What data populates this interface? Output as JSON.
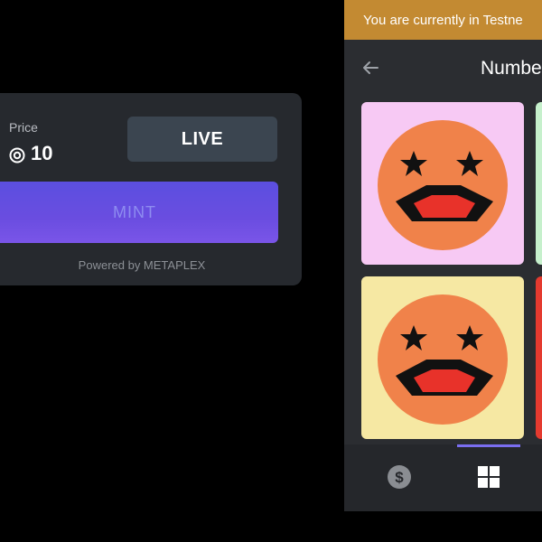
{
  "mint_card": {
    "price_label": "Price",
    "price_value": "10",
    "live_label": "LIVE",
    "mint_label": "MINT",
    "powered_by": "Powered by METAPLEX",
    "icons": {
      "price": "sol-coin-icon"
    }
  },
  "phone": {
    "banner_text": "You are currently in Testne",
    "title": "Numbe",
    "icons": {
      "back": "back-arrow-icon",
      "nav_wallet": "dollar-coin-icon",
      "nav_gallery": "grid-icon"
    },
    "tiles": [
      {
        "bg": "#f7c9f4",
        "icon": "star-eyes-face-icon"
      },
      {
        "bg": "#f6e8a3",
        "icon": "star-eyes-face-icon"
      }
    ],
    "colors": {
      "banner": "#c38a32",
      "face": "#f0824a",
      "mouth": "#e8322a",
      "nav_indicator": "#7a6ef0"
    }
  },
  "colors": {
    "mint_gradient_start": "#5b4fe0",
    "live_button": "#3b4550",
    "card_bg": "#26292e"
  }
}
